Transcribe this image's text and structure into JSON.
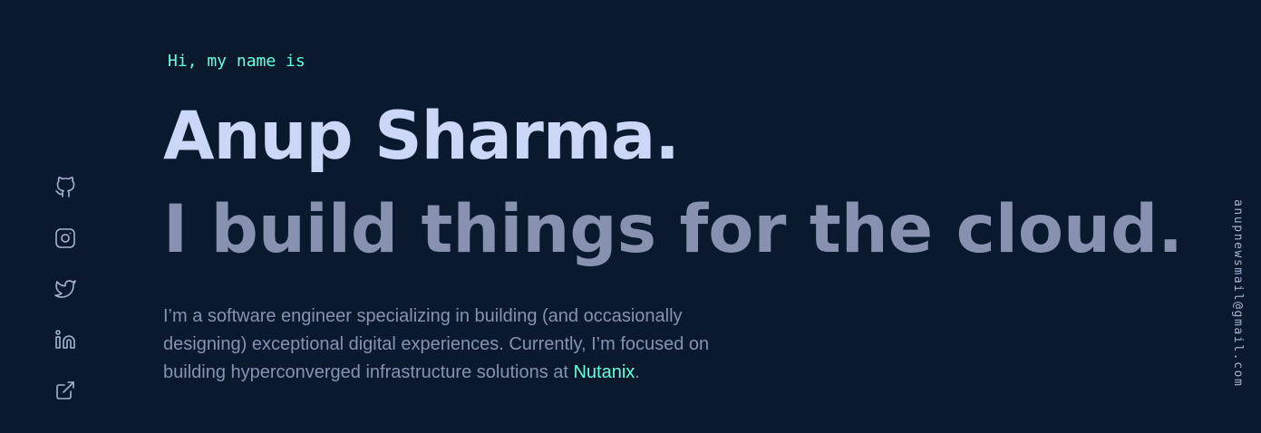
{
  "greeting": "Hi, my name is",
  "name": "Anup Sharma.",
  "tagline": "I build things for the cloud.",
  "intro": {
    "text_before": "I’m a software engineer specializing in building (and occasionally designing) exceptional digital experiences. Currently, I’m focused on building hyperconverged infrastructure solutions at ",
    "company": "Nutanix",
    "text_after": "."
  },
  "email": "anupnewsmail@gmail.com",
  "social_icons": [
    "github-icon",
    "instagram-icon",
    "twitter-icon",
    "linkedin-icon",
    "external-link-icon"
  ],
  "colors": {
    "background": "#0b192f",
    "accent": "#64ffda",
    "heading": "#ccd6f6",
    "text": "#8892b0",
    "icon": "#a8b2d1"
  }
}
